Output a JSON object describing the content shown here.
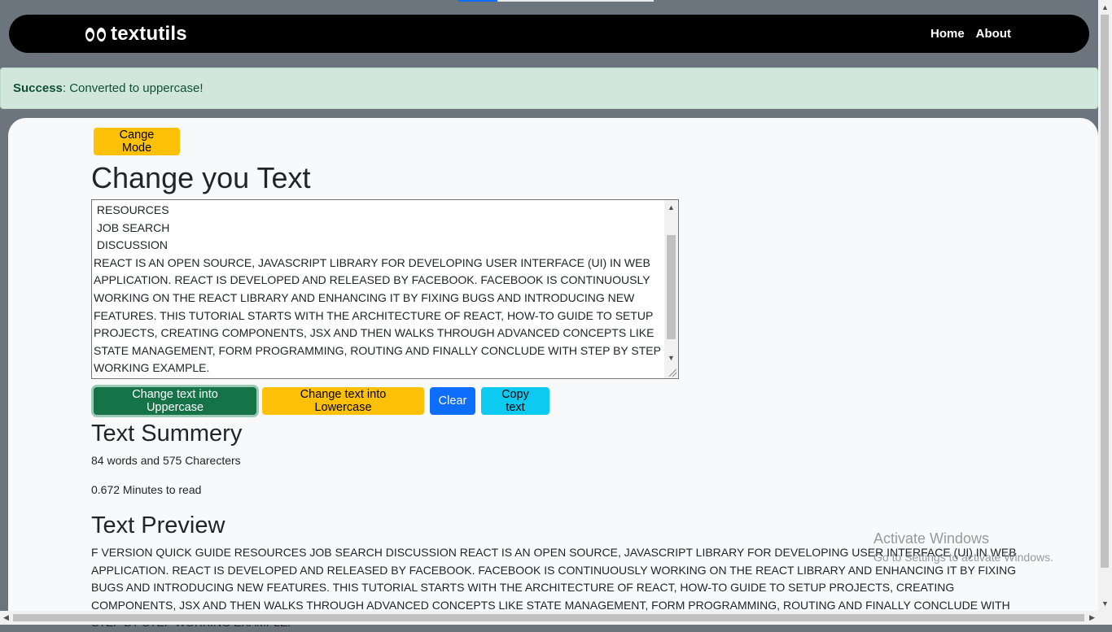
{
  "navbar": {
    "brand": "textutils",
    "links": [
      "Home",
      "About"
    ]
  },
  "alert": {
    "type": "Success",
    "message": ": Converted to uppercase!"
  },
  "mode_button": "Cange Mode",
  "heading": "Change you Text",
  "textarea_value": " RESOURCES\n JOB SEARCH\n DISCUSSION\nREACT IS AN OPEN SOURCE, JAVASCRIPT LIBRARY FOR DEVELOPING USER INTERFACE (UI) IN WEB APPLICATION. REACT IS DEVELOPED AND RELEASED BY FACEBOOK. FACEBOOK IS CONTINUOUSLY WORKING ON THE REACT LIBRARY AND ENHANCING IT BY FIXING BUGS AND INTRODUCING NEW FEATURES. THIS TUTORIAL STARTS WITH THE ARCHITECTURE OF REACT, HOW-TO GUIDE TO SETUP PROJECTS, CREATING COMPONENTS, JSX AND THEN WALKS THROUGH ADVANCED CONCEPTS LIKE STATE MANAGEMENT, FORM PROGRAMMING, ROUTING AND FINALLY CONCLUDE WITH STEP BY STEP WORKING EXAMPLE.",
  "buttons": {
    "uppercase": "Change text into Uppercase",
    "lowercase": "Change text into Lowercase",
    "clear": "Clear",
    "copy": "Copy text"
  },
  "summary": {
    "heading": "Text Summery",
    "counts": "84 words and 575 Charecters",
    "read_time": "0.672 Minutes to read"
  },
  "preview": {
    "heading": "Text Preview",
    "text": "F VERSION QUICK GUIDE RESOURCES JOB SEARCH DISCUSSION REACT IS AN OPEN SOURCE, JAVASCRIPT LIBRARY FOR DEVELOPING USER INTERFACE (UI) IN WEB APPLICATION. REACT IS DEVELOPED AND RELEASED BY FACEBOOK. FACEBOOK IS CONTINUOUSLY WORKING ON THE REACT LIBRARY AND ENHANCING IT BY FIXING BUGS AND INTRODUCING NEW FEATURES. THIS TUTORIAL STARTS WITH THE ARCHITECTURE OF REACT, HOW-TO GUIDE TO SETUP PROJECTS, CREATING COMPONENTS, JSX AND THEN WALKS THROUGH ADVANCED CONCEPTS LIKE STATE MANAGEMENT, FORM PROGRAMMING, ROUTING AND FINALLY CONCLUDE WITH STEP BY STEP WORKING EXAMPLE."
  },
  "watermark": {
    "line1": "Activate Windows",
    "line2": "Go to Settings to activate Windows."
  },
  "colors": {
    "navbar": "#000000",
    "success_bg": "#d1e7dd",
    "warning": "#ffc107",
    "success": "#157347",
    "primary": "#0d6efd",
    "info": "#0dcaf0"
  }
}
